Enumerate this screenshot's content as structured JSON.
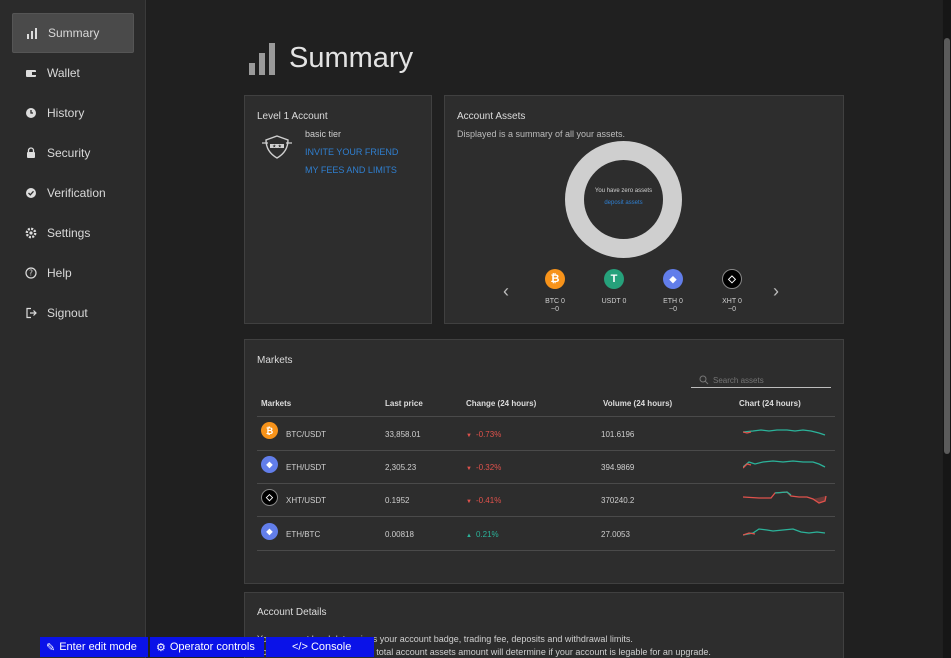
{
  "sidebar": {
    "items": [
      {
        "label": "Summary",
        "icon": "bar-chart-icon",
        "active": true
      },
      {
        "label": "Wallet",
        "icon": "wallet-icon"
      },
      {
        "label": "History",
        "icon": "clock-icon"
      },
      {
        "label": "Security",
        "icon": "lock-icon"
      },
      {
        "label": "Verification",
        "icon": "check-badge-icon"
      },
      {
        "label": "Settings",
        "icon": "gear-icon"
      },
      {
        "label": "Help",
        "icon": "help-icon"
      },
      {
        "label": "Signout",
        "icon": "signout-icon"
      }
    ]
  },
  "page": {
    "title": "Summary"
  },
  "level_card": {
    "title": "Level 1 Account",
    "tier": "basic tier",
    "invite_link": "INVITE YOUR FRIEND",
    "fees_link": "MY FEES AND LIMITS"
  },
  "assets_card": {
    "title": "Account Assets",
    "subtitle": "Displayed is a summary of all your assets.",
    "donut_text": "You have zero assets",
    "donut_link": "deposit assets",
    "coins": [
      {
        "symbol": "BTC",
        "label": "BTC 0",
        "value": "~0",
        "color": "#f7931a",
        "glyph": "₿"
      },
      {
        "symbol": "USDT",
        "label": "USDT 0",
        "value": "",
        "color": "#26a17b",
        "glyph": "T"
      },
      {
        "symbol": "ETH",
        "label": "ETH 0",
        "value": "~0",
        "color": "#627eea",
        "glyph": "◆"
      },
      {
        "symbol": "XHT",
        "label": "XHT 0",
        "value": "~0",
        "color": "#000000",
        "glyph": "◇"
      }
    ]
  },
  "markets_card": {
    "title": "Markets",
    "search_placeholder": "Search assets",
    "columns": [
      "Markets",
      "Last price",
      "Change (24 hours)",
      "Volume (24 hours)",
      "Chart (24 hours)"
    ],
    "rows": [
      {
        "pair": "BTC/USDT",
        "coin": "BTC",
        "last_price": "33,858.01",
        "change": "-0.73%",
        "direction": "down",
        "volume": "101.6196"
      },
      {
        "pair": "ETH/USDT",
        "coin": "ETH",
        "last_price": "2,305.23",
        "change": "-0.32%",
        "direction": "down",
        "volume": "394.9869"
      },
      {
        "pair": "XHT/USDT",
        "coin": "XHT",
        "last_price": "0.1952",
        "change": "-0.41%",
        "direction": "down",
        "volume": "370240.2"
      },
      {
        "pair": "ETH/BTC",
        "coin": "ETH",
        "last_price": "0.00818",
        "change": "0.21%",
        "direction": "up",
        "volume": "27.0053"
      }
    ]
  },
  "details_card": {
    "title": "Account Details",
    "line1": "Your account level determines your account badge, trading fee, deposits and withdrawal limits.",
    "line2": "Your trading activity level and total account assets amount will determine if your account is legable for an upgrade."
  },
  "toolbar": {
    "edit": "Enter edit mode",
    "operator": "Operator controls",
    "console": "</> Console"
  },
  "colors": {
    "link": "#2f7fd0",
    "negative": "#e0524c",
    "positive": "#2bb39a",
    "toolbar": "#0a12e8"
  }
}
